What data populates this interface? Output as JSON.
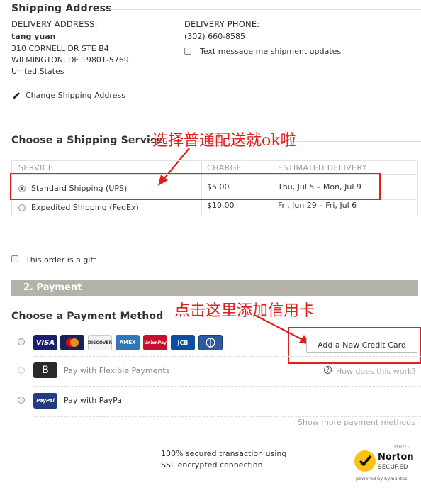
{
  "shipping_address": {
    "title": "Shipping Address",
    "delivery_address_label": "DELIVERY ADDRESS:",
    "name": "tang yuan",
    "street": "310 CORNELL DR STE B4",
    "city": "WILMINGTON, DE 19801-5769",
    "country": "United States",
    "delivery_phone_label": "DELIVERY PHONE:",
    "phone": "(302) 660-8585",
    "sms_label": "Text message me shipment updates",
    "change_link": "Change Shipping Address"
  },
  "shipping_service": {
    "title": "Choose a Shipping Service",
    "annotation": "选择普通配送就ok啦",
    "headers": [
      "SERVICE",
      "CHARGE",
      "ESTIMATED DELIVERY"
    ],
    "rows": [
      {
        "service": "Standard Shipping (UPS)",
        "charge": "$5.00",
        "delivery": "Thu, Jul 5 – Mon, Jul 9",
        "selected": true
      },
      {
        "service": "Expedited Shipping (FedEx)",
        "charge": "$10.00",
        "delivery": "Fri, Jun 29 – Fri, Jul 6",
        "selected": false
      }
    ]
  },
  "gift": {
    "label": "This order is a gift"
  },
  "payment": {
    "section_title": "2. Payment",
    "title": "Choose a Payment Method",
    "annotation": "点击这里添加信用卡",
    "cards": [
      "VISA",
      "MC",
      "DISCOVER",
      "AMEX",
      "UnionPay",
      "JCB",
      "Diners"
    ],
    "add_card_button": "Add a New Credit Card",
    "flexible_badge": "B",
    "flexible_label": "Pay with Flexible Payments",
    "how_link": "How does this work?",
    "help_icon": "?",
    "paypal_badge": "PayPal",
    "paypal_label": "Pay with PayPal",
    "show_more": "Show more payment methods"
  },
  "security": {
    "line1": "100% secured transaction using",
    "line2": "SSL encrypted connection",
    "norton_verify": "VERIFY ›",
    "norton_brand": "Norton",
    "norton_secured": "SECURED",
    "norton_powered": "powered by Symantec"
  },
  "colors": {
    "annotation_red": "#e0201e",
    "payment_bar": "#b4b1ab",
    "visa": "#1a1f71",
    "mastercard": "#14245a",
    "discover": "#f2f2f2",
    "amex": "#2e77bb",
    "unionpay": "#c8102e",
    "jcb": "#0b4ea2",
    "diners": "#2c5aa0",
    "norton_yellow": "#ffc20e"
  }
}
